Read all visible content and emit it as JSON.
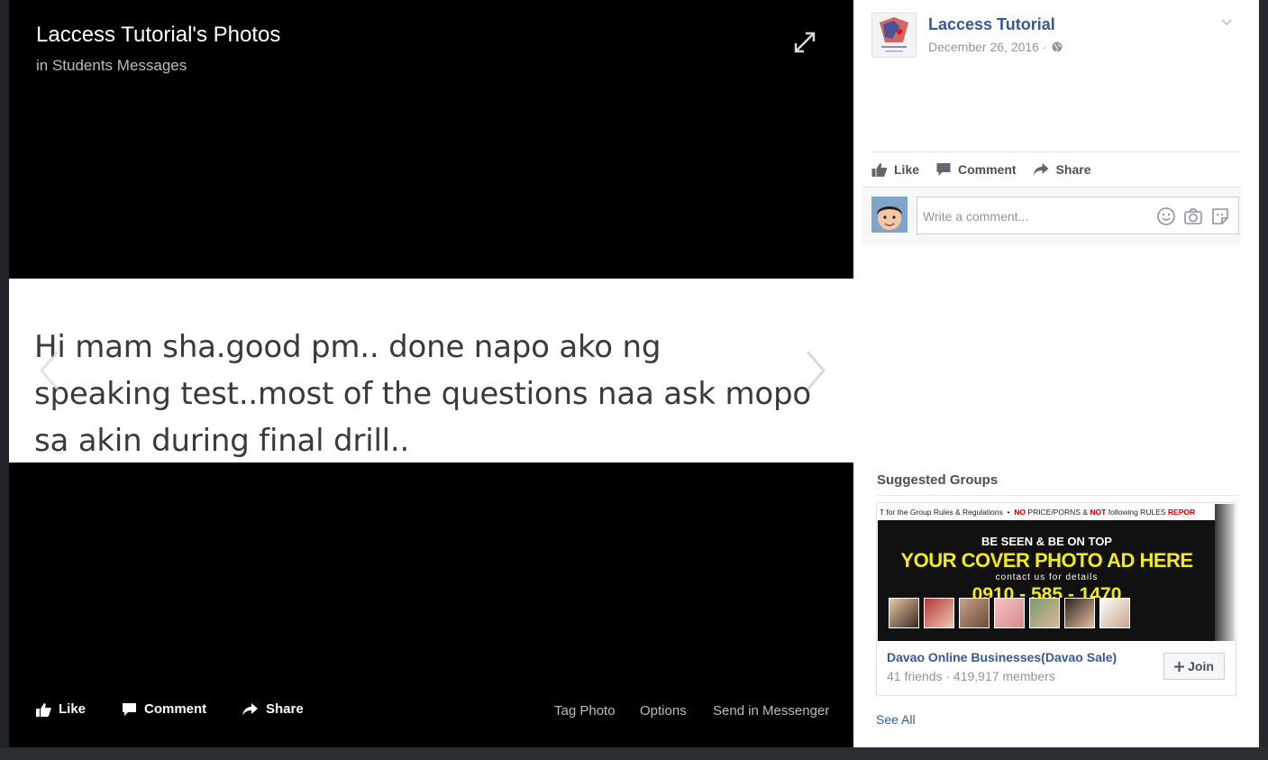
{
  "viewer": {
    "title": "Laccess Tutorial's Photos",
    "album_line": "in Students Messages",
    "photo_text": "Hi mam sha.good pm.. done napo ako ng\nspeaking test..most of the questions naa ask mopo\nsa akin during final drill..",
    "actions": {
      "like": "Like",
      "comment": "Comment",
      "share": "Share"
    },
    "links": {
      "tag_photo": "Tag Photo",
      "options": "Options",
      "send_in_messenger": "Send in Messenger"
    }
  },
  "sidebar": {
    "page_name": "Laccess Tutorial",
    "date": "December 26, 2016 ·",
    "actions": {
      "like": "Like",
      "comment": "Comment",
      "share": "Share"
    },
    "comment_placeholder": "Write a comment...",
    "suggested_title": "Suggested Groups",
    "group": {
      "cover_rules": [
        "T for the Group Rules & Regulations",
        "NO",
        "PRICE/PORNS",
        "&",
        "NOT",
        "following RULES",
        "REPOR"
      ],
      "cover_line1": "BE SEEN & BE ON TOP",
      "cover_line2": "YOUR COVER PHOTO AD HERE",
      "cover_line3": "contact us for details",
      "cover_line4": "0910 - 585 - 1470",
      "name": "Davao Online Businesses(Davao Sale)",
      "meta": "41 friends · 419,917 members",
      "join": "Join"
    },
    "see_all": "See All"
  },
  "colors": {
    "link": "#365899",
    "cover_yellow": "#f2ea1f"
  },
  "icons": [
    "expand-icon",
    "prev-arrow-icon",
    "next-arrow-icon",
    "thumbs-up-icon",
    "comment-icon",
    "share-icon",
    "chevron-down-icon",
    "globe-icon",
    "emoji-icon",
    "camera-icon",
    "sticker-icon",
    "plus-icon"
  ]
}
